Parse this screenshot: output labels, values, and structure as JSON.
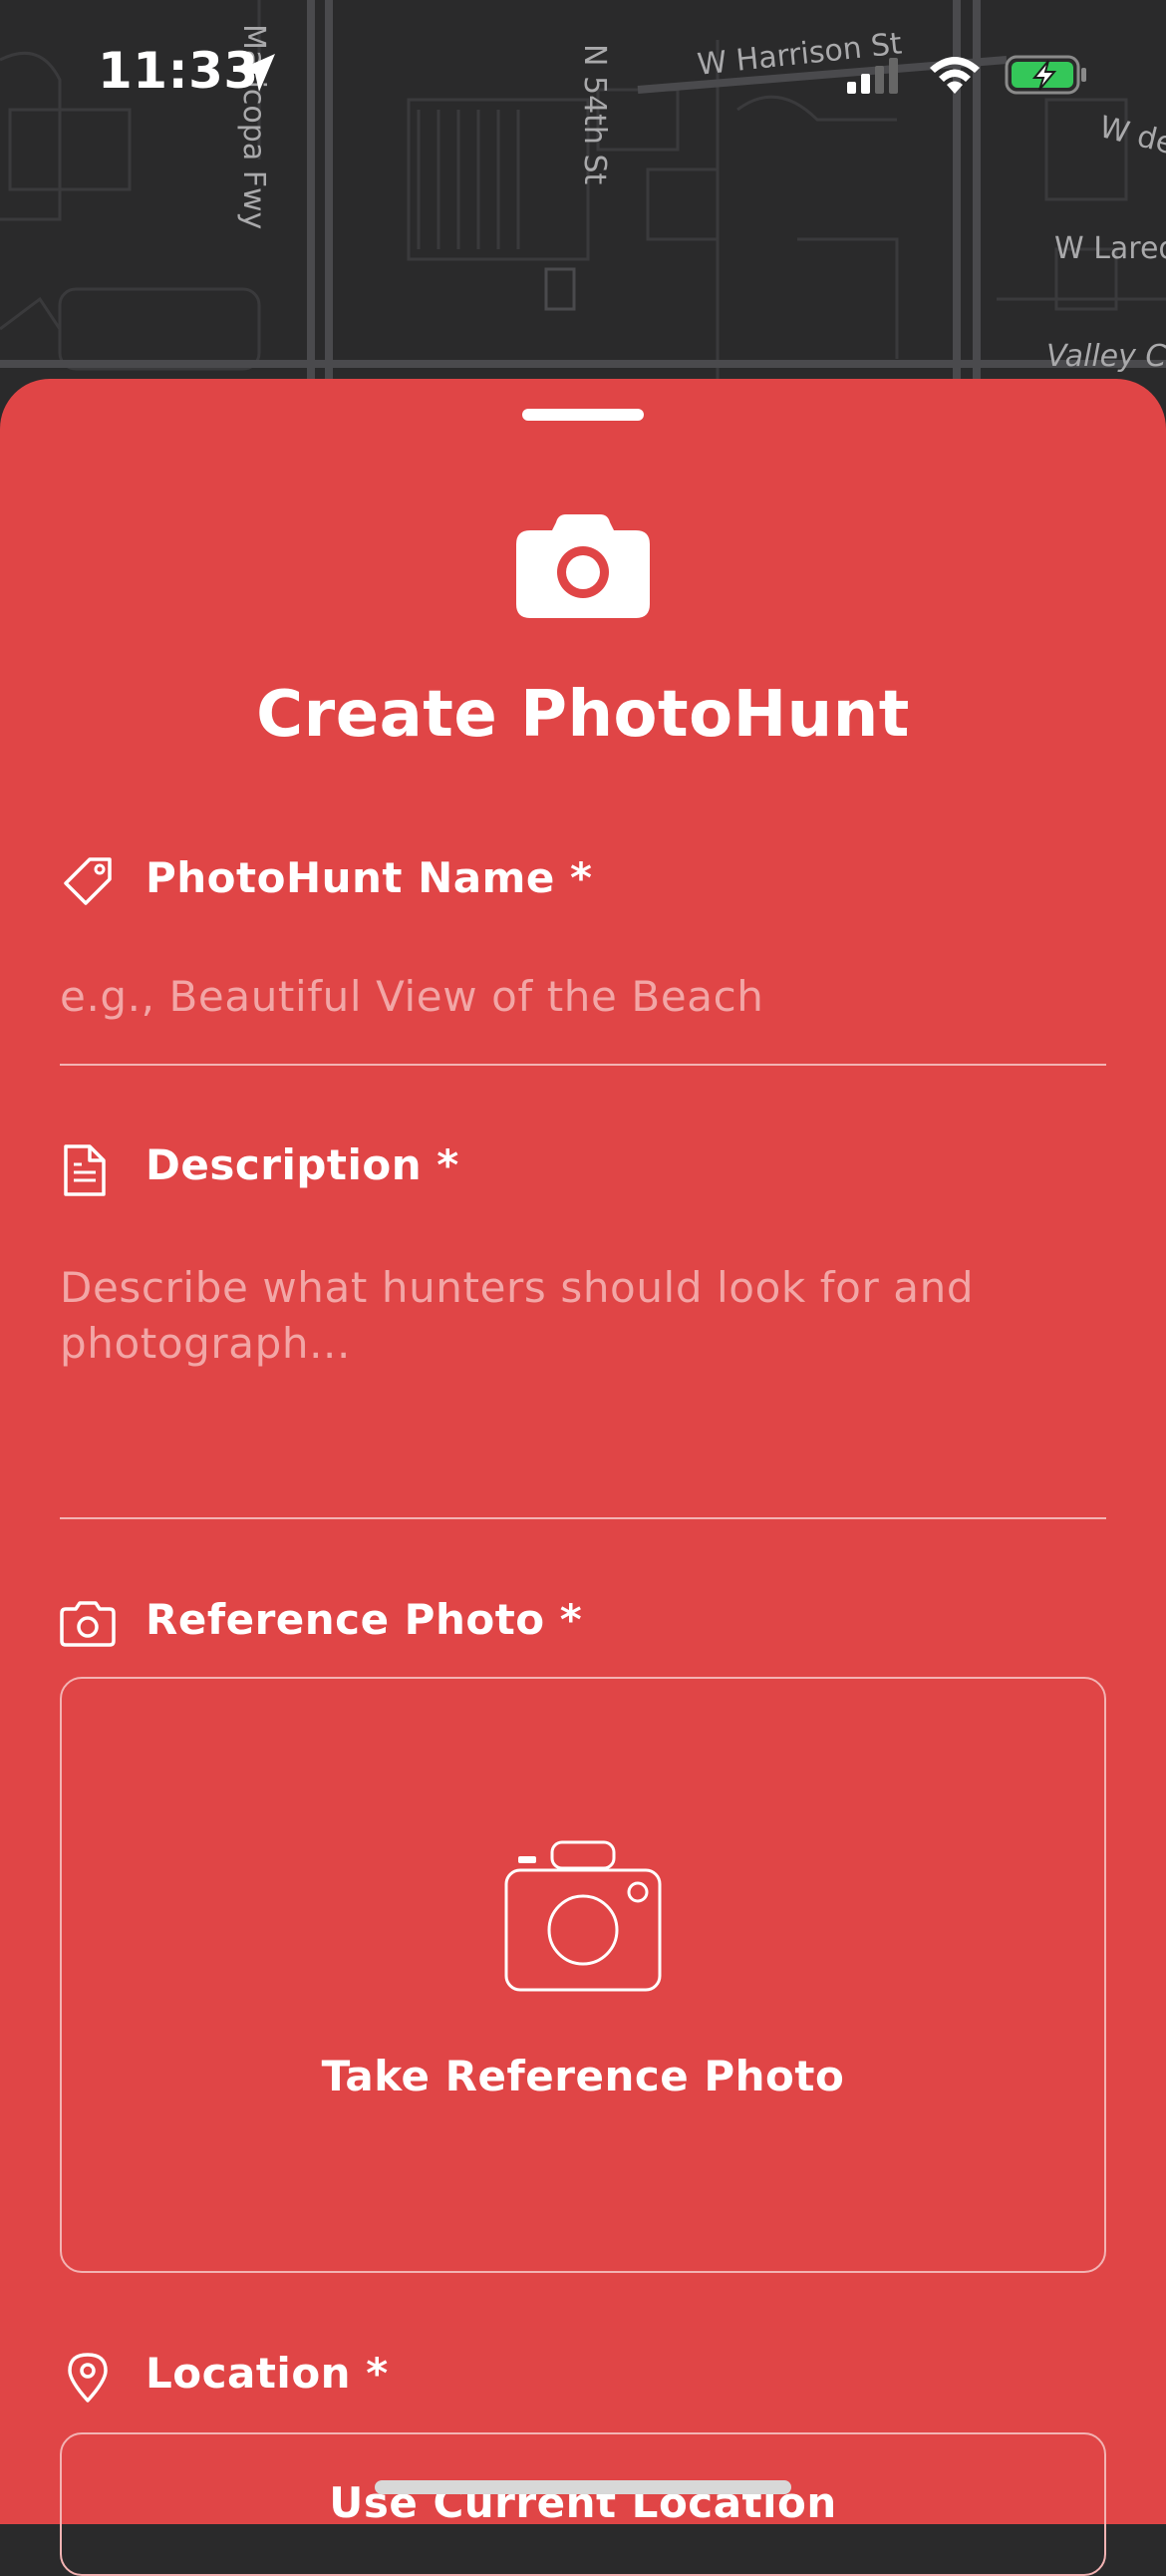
{
  "status_bar": {
    "time": "11:33"
  },
  "map": {
    "labels": [
      "Maricopa Fwy",
      "N 54th St",
      "W Harrison St",
      "W Lared",
      "Valley Cr",
      "W de"
    ]
  },
  "sheet": {
    "title": "Create PhotoHunt",
    "name_field": {
      "label": "PhotoHunt Name *",
      "placeholder": "e.g., Beautiful View of the Beach",
      "value": ""
    },
    "description_field": {
      "label": "Description *",
      "placeholder": "Describe what hunters should look for and photograph...",
      "value": ""
    },
    "reference_photo": {
      "label": "Reference Photo *",
      "button_label": "Take Reference Photo"
    },
    "location": {
      "label": "Location *",
      "button_label": "Use Current Location"
    }
  },
  "colors": {
    "sheet_background": "#e04546",
    "map_background": "#2a2a2b",
    "placeholder": "#f2a6a6"
  },
  "icons": [
    "location-arrow-icon",
    "signal-icon",
    "wifi-icon",
    "battery-charging-icon",
    "camera-icon",
    "tag-icon",
    "document-icon",
    "camera-outline-icon",
    "map-pin-icon"
  ]
}
